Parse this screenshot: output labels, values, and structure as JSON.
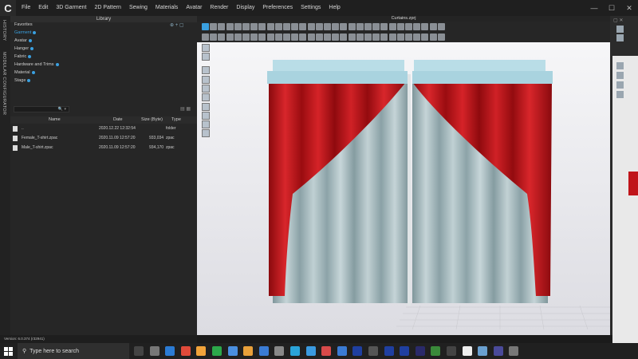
{
  "app": {
    "logo_letter": "C",
    "menu": [
      "File",
      "Edit",
      "3D Garment",
      "2D Pattern",
      "Sewing",
      "Materials",
      "Avatar",
      "Render",
      "Display",
      "Preferences",
      "Settings",
      "Help"
    ],
    "window_controls": {
      "minimize": "—",
      "maximize": "☐",
      "close": "✕"
    }
  },
  "side_tabs": [
    "HISTORY",
    "MODULAR CONFIGURATOR"
  ],
  "library": {
    "title": "Library",
    "favorites_label": "Favorites",
    "items": [
      "Garment",
      "Avatar",
      "Hanger",
      "Fabric",
      "Hardware and Trims",
      "Material",
      "Stage"
    ],
    "selected_item": "Garment",
    "search_placeholder": "🔍 ▾",
    "columns": {
      "name": "Name",
      "date": "Date",
      "size": "Size (Byte)",
      "type": "Type"
    },
    "files": [
      {
        "name": "..",
        "date": "2020.12.22 12:32:54",
        "size": "",
        "type": "folder"
      },
      {
        "name": "Female_T-shirt.zpac",
        "date": "2020.11.09 12:57:20",
        "size": "933,034",
        "type": "zpac"
      },
      {
        "name": "Male_T-shirt.zpac",
        "date": "2020.11.09 12:57:20",
        "size": "934,170",
        "type": "zpac"
      }
    ]
  },
  "status_bar": {
    "version": "Version: 6.0.374 (r32941)"
  },
  "viewport": {
    "title": "Curtains.zprj"
  },
  "colors": {
    "accent": "#3aa0e0",
    "curtain_red": "#c0141a",
    "sheer": "#a9bdc2",
    "valance": "#a9d3df"
  },
  "taskbar": {
    "search_placeholder": "Type here to search"
  }
}
